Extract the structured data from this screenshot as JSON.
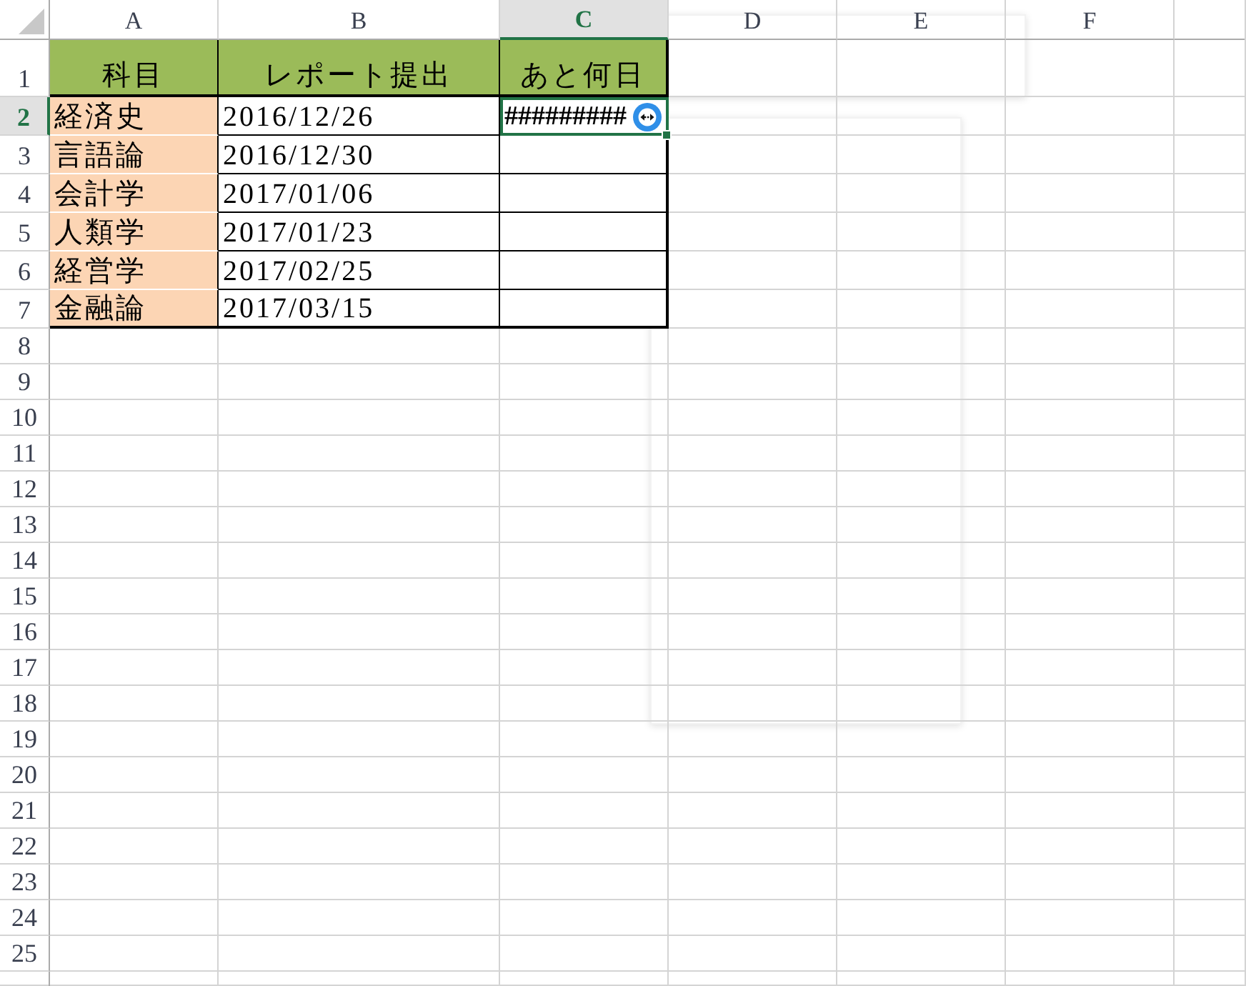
{
  "column_headers": [
    {
      "label": "A",
      "selected": false
    },
    {
      "label": "B",
      "selected": false
    },
    {
      "label": "C",
      "selected": true
    },
    {
      "label": "D",
      "selected": false
    },
    {
      "label": "E",
      "selected": false
    },
    {
      "label": "F",
      "selected": false
    }
  ],
  "row_headers": [
    {
      "label": "1",
      "selected": false
    },
    {
      "label": "2",
      "selected": true
    },
    {
      "label": "3",
      "selected": false
    },
    {
      "label": "4",
      "selected": false
    },
    {
      "label": "5",
      "selected": false
    },
    {
      "label": "6",
      "selected": false
    },
    {
      "label": "7",
      "selected": false
    },
    {
      "label": "8",
      "selected": false
    },
    {
      "label": "9",
      "selected": false
    },
    {
      "label": "10",
      "selected": false
    },
    {
      "label": "11",
      "selected": false
    },
    {
      "label": "12",
      "selected": false
    },
    {
      "label": "13",
      "selected": false
    },
    {
      "label": "14",
      "selected": false
    },
    {
      "label": "15",
      "selected": false
    },
    {
      "label": "16",
      "selected": false
    },
    {
      "label": "17",
      "selected": false
    },
    {
      "label": "18",
      "selected": false
    },
    {
      "label": "19",
      "selected": false
    },
    {
      "label": "20",
      "selected": false
    },
    {
      "label": "21",
      "selected": false
    },
    {
      "label": "22",
      "selected": false
    },
    {
      "label": "23",
      "selected": false
    },
    {
      "label": "24",
      "selected": false
    },
    {
      "label": "25",
      "selected": false
    }
  ],
  "table": {
    "columns": [
      "科目",
      "レポート提出",
      "あと何日"
    ],
    "rows": [
      {
        "cells": [
          {
            "text": "経済史",
            "selected": false
          },
          {
            "text": "2016/12/26",
            "selected": false
          },
          {
            "text": "#########",
            "selected": true
          }
        ]
      },
      {
        "cells": [
          {
            "text": "言語論",
            "selected": false
          },
          {
            "text": "2016/12/30",
            "selected": false
          },
          {
            "selected": false
          }
        ]
      },
      {
        "cells": [
          {
            "text": "会計学",
            "selected": false
          },
          {
            "text": "2017/01/06",
            "selected": false
          },
          {
            "selected": false
          }
        ]
      },
      {
        "cells": [
          {
            "text": "人類学",
            "selected": false
          },
          {
            "text": "2017/01/23",
            "selected": false
          },
          {
            "selected": false
          }
        ]
      },
      {
        "cells": [
          {
            "text": "経営学",
            "selected": false
          },
          {
            "text": "2017/02/25",
            "selected": false
          },
          {
            "selected": false
          }
        ]
      },
      {
        "cells": [
          {
            "text": "金融論",
            "selected": false
          },
          {
            "text": "2017/03/15",
            "selected": false
          },
          {
            "selected": false
          }
        ]
      }
    ]
  }
}
